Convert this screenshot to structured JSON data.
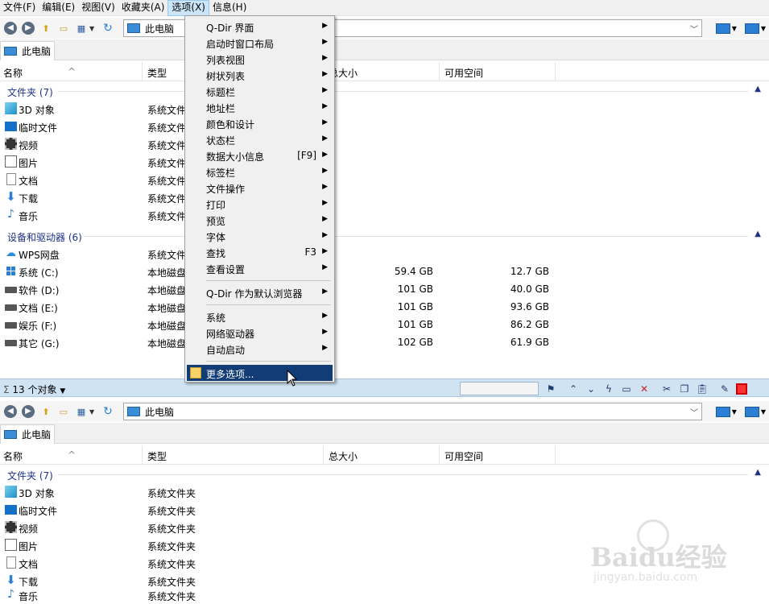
{
  "menubar": {
    "items": [
      "文件(F)",
      "编辑(E)",
      "视图(V)",
      "收藏夹(A)",
      "选项(X)",
      "信息(H)"
    ],
    "active_index": 4
  },
  "address": {
    "path": "此电脑"
  },
  "tab": {
    "label": "此电脑"
  },
  "columns": {
    "name": "名称",
    "type": "类型",
    "total": "总大小",
    "free": "可用空间"
  },
  "pane_top": {
    "groups": [
      {
        "title": "文件夹 (7)"
      },
      {
        "title": "设备和驱动器 (6)"
      }
    ],
    "folders": [
      {
        "name": "3D 对象",
        "type": "系统文件夹",
        "icon": "cube-3d-icon"
      },
      {
        "name": "临时文件",
        "type": "系统文件夹",
        "icon": "temp-folder-icon"
      },
      {
        "name": "视频",
        "type": "系统文件夹",
        "icon": "film-icon"
      },
      {
        "name": "图片",
        "type": "系统文件夹",
        "icon": "picture-icon"
      },
      {
        "name": "文档",
        "type": "系统文件夹",
        "icon": "document-icon"
      },
      {
        "name": "下载",
        "type": "系统文件夹",
        "icon": "download-arrow-icon"
      },
      {
        "name": "音乐",
        "type": "系统文件夹",
        "icon": "music-note-icon"
      }
    ],
    "drives": [
      {
        "name": "WPS网盘",
        "type": "系统文件夹",
        "total": "",
        "free": "",
        "icon": "cloud-icon"
      },
      {
        "name": "系统 (C:)",
        "type": "本地磁盘",
        "total": "59.4 GB",
        "free": "12.7 GB",
        "icon": "windows-drive-icon"
      },
      {
        "name": "软件 (D:)",
        "type": "本地磁盘",
        "total": "101 GB",
        "free": "40.0 GB",
        "icon": "drive-icon"
      },
      {
        "name": "文档 (E:)",
        "type": "本地磁盘",
        "total": "101 GB",
        "free": "93.6 GB",
        "icon": "drive-icon"
      },
      {
        "name": "娱乐 (F:)",
        "type": "本地磁盘",
        "total": "101 GB",
        "free": "86.2 GB",
        "icon": "drive-icon"
      },
      {
        "name": "其它 (G:)",
        "type": "本地磁盘",
        "total": "102 GB",
        "free": "61.9 GB",
        "icon": "drive-icon"
      }
    ]
  },
  "status": {
    "text": "13 个对象"
  },
  "pane_bottom": {
    "groups": [
      {
        "title": "文件夹 (7)"
      }
    ],
    "folders": [
      {
        "name": "3D 对象",
        "type": "系统文件夹"
      },
      {
        "name": "临时文件",
        "type": "系统文件夹"
      },
      {
        "name": "视频",
        "type": "系统文件夹"
      },
      {
        "name": "图片",
        "type": "系统文件夹"
      },
      {
        "name": "文档",
        "type": "系统文件夹"
      },
      {
        "name": "下载",
        "type": "系统文件夹"
      },
      {
        "name": "音乐",
        "type": "系统文件夹"
      }
    ]
  },
  "options_menu": {
    "items": [
      {
        "label": "Q-Dir 界面",
        "key": "",
        "submenu": true
      },
      {
        "label": "启动时窗口布局",
        "key": "",
        "submenu": true
      },
      {
        "label": "列表视图",
        "key": "",
        "submenu": true
      },
      {
        "label": "树状列表",
        "key": "",
        "submenu": true
      },
      {
        "label": "标题栏",
        "key": "",
        "submenu": true
      },
      {
        "label": "地址栏",
        "key": "",
        "submenu": true
      },
      {
        "label": "颜色和设计",
        "key": "",
        "submenu": true
      },
      {
        "label": "状态栏",
        "key": "",
        "submenu": true
      },
      {
        "label": "数据大小信息",
        "key": "[F9]",
        "submenu": true
      },
      {
        "label": "标签栏",
        "key": "",
        "submenu": true
      },
      {
        "label": "文件操作",
        "key": "",
        "submenu": true
      },
      {
        "label": "打印",
        "key": "",
        "submenu": true
      },
      {
        "label": "预览",
        "key": "",
        "submenu": true
      },
      {
        "label": "字体",
        "key": "",
        "submenu": true
      },
      {
        "label": "查找",
        "key": "F3",
        "submenu": true
      },
      {
        "label": "查看设置",
        "key": "",
        "submenu": true
      }
    ],
    "items_group2": [
      {
        "label": "Q-Dir 作为默认浏览器",
        "submenu": true
      }
    ],
    "items_group3": [
      {
        "label": "系统",
        "submenu": true
      },
      {
        "label": "网络驱动器",
        "submenu": true
      },
      {
        "label": "自动启动",
        "submenu": true
      }
    ],
    "highlighted": {
      "label": "更多选项..."
    }
  },
  "watermark": {
    "brand": "Baidu经验",
    "url": "jingyan.baidu.com"
  }
}
